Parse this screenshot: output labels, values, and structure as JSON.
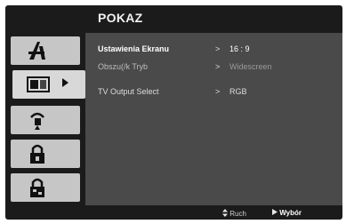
{
  "menu": {
    "title": "POKAZ",
    "tabs": [
      {
        "icon": "dvd-disc-icon"
      },
      {
        "icon": "screen-icon"
      },
      {
        "icon": "speaker-icon"
      },
      {
        "icon": "lock-icon"
      },
      {
        "icon": "lock-settings-icon"
      }
    ],
    "rows": [
      {
        "label": "Ustawienia Ekranu",
        "value": "16 : 9"
      },
      {
        "label": "Obszu(/k Tryb",
        "value": "Widescreen"
      },
      {
        "label": "TV Output Select",
        "value": "RGB"
      }
    ],
    "pointer": ">",
    "footer": {
      "move_icon": "updown-arrows-icon",
      "move_label": "Ruch",
      "select_icon": "right-arrow-icon",
      "select_label": "Wybór"
    }
  },
  "colors": {
    "frame": "#1b1b1b",
    "content": "#4a4a4a",
    "tab": "#c6c6c6"
  }
}
